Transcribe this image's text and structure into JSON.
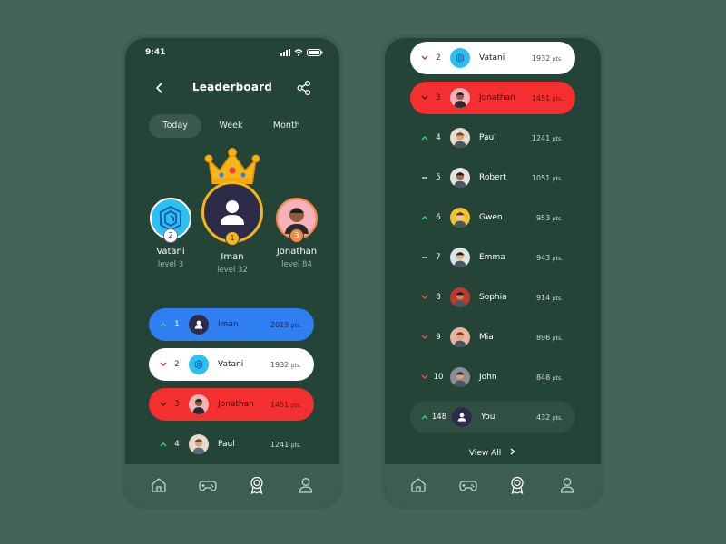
{
  "status": {
    "time": "9:41"
  },
  "header": {
    "title": "Leaderboard"
  },
  "tabs": [
    {
      "label": "Today"
    },
    {
      "label": "Week"
    },
    {
      "label": "Month"
    }
  ],
  "podium": {
    "second": {
      "name": "Vatani",
      "level": "level 3",
      "rank": "2"
    },
    "first": {
      "name": "Iman",
      "level": "level 32",
      "rank": "1"
    },
    "third": {
      "name": "Jonathan",
      "level": "level 84",
      "rank": "3"
    }
  },
  "list_left": [
    {
      "rank": "1",
      "name": "Iman",
      "points": "2019",
      "unit": "pts.",
      "trend": "up"
    },
    {
      "rank": "2",
      "name": "Vatani",
      "points": "1932",
      "unit": "pts.",
      "trend": "down"
    },
    {
      "rank": "3",
      "name": "Jonathan",
      "points": "1451",
      "unit": "pts.",
      "trend": "down"
    },
    {
      "rank": "4",
      "name": "Paul",
      "points": "1241",
      "unit": "pts.",
      "trend": "up"
    }
  ],
  "list_right": [
    {
      "rank": "2",
      "name": "Vatani",
      "points": "1932",
      "unit": "pts.",
      "trend": "down"
    },
    {
      "rank": "3",
      "name": "Jonathan",
      "points": "1451",
      "unit": "pts.",
      "trend": "down"
    },
    {
      "rank": "4",
      "name": "Paul",
      "points": "1241",
      "unit": "pts.",
      "trend": "up"
    },
    {
      "rank": "5",
      "name": "Robert",
      "points": "1051",
      "unit": "pts.",
      "trend": "same"
    },
    {
      "rank": "6",
      "name": "Gwen",
      "points": "953",
      "unit": "pts.",
      "trend": "up"
    },
    {
      "rank": "7",
      "name": "Emma",
      "points": "943",
      "unit": "pts.",
      "trend": "same"
    },
    {
      "rank": "8",
      "name": "Sophia",
      "points": "914",
      "unit": "pts.",
      "trend": "down"
    },
    {
      "rank": "9",
      "name": "Mia",
      "points": "896",
      "unit": "pts.",
      "trend": "down"
    },
    {
      "rank": "10",
      "name": "John",
      "points": "848",
      "unit": "pts.",
      "trend": "down"
    }
  ],
  "you": {
    "rank": "148",
    "name": "You",
    "points": "432",
    "unit": "pts.",
    "trend": "up"
  },
  "view_all": "View All",
  "nav": [
    {
      "icon": "home-icon"
    },
    {
      "icon": "gamepad-icon"
    },
    {
      "icon": "award-icon"
    },
    {
      "icon": "profile-icon"
    }
  ],
  "colors": {
    "bg": "#44625a",
    "panel": "#244437",
    "blue": "#2f7ef2",
    "red": "#f42f2f",
    "gold": "#f6b61a",
    "up": "#36d77b",
    "down": "#ef4c4c"
  }
}
